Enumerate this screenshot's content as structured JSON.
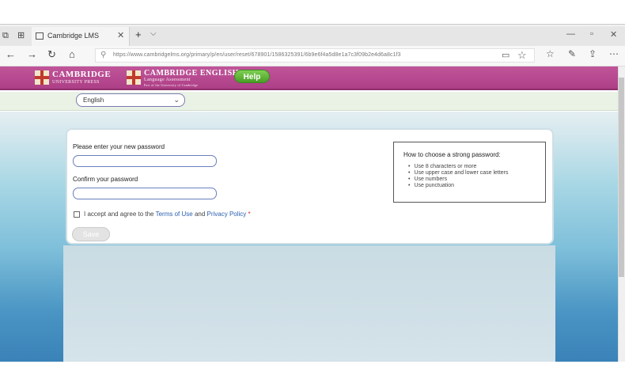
{
  "browser": {
    "tab_title": "Cambridge LMS",
    "url": "https://www.cambridgelms.org/primary/p/en/user/reset/678901/1586325391/6b9e6f4a5d8e1a7c3f09b2e4d6a8c1f3",
    "icons": [
      "back-arrow-icon",
      "forward-arrow-icon",
      "refresh-icon",
      "home-icon",
      "lock-icon",
      "reading-view-icon",
      "favorite-star-icon",
      "favorites-icon",
      "pen-icon",
      "share-icon",
      "more-icon"
    ]
  },
  "header": {
    "logo1_main": "CAMBRIDGE",
    "logo1_sub": "UNIVERSITY PRESS",
    "logo2_main": "CAMBRIDGE ENGLISH",
    "logo2_sub": "Language Assessment",
    "logo2_sub2": "Part of the University of Cambridge",
    "help_label": "Help"
  },
  "language": {
    "selected": "English"
  },
  "form": {
    "new_password_label": "Please enter your new password",
    "confirm_password_label": "Confirm your password",
    "terms_prefix": "I accept and agree to the ",
    "terms_link": "Terms of Use",
    "terms_and": " and ",
    "privacy_link": "Privacy Policy",
    "required_marker": " *",
    "save_label": "Save"
  },
  "tips": {
    "title": "How to choose a strong password:",
    "items": [
      "Use 8 characters or more",
      "Use upper case and lower case letters",
      "Use numbers",
      "Use punctuation"
    ]
  },
  "colors": {
    "header_magenta": "#b8478f",
    "help_green": "#5cb532",
    "link_blue": "#2a5fb0"
  }
}
